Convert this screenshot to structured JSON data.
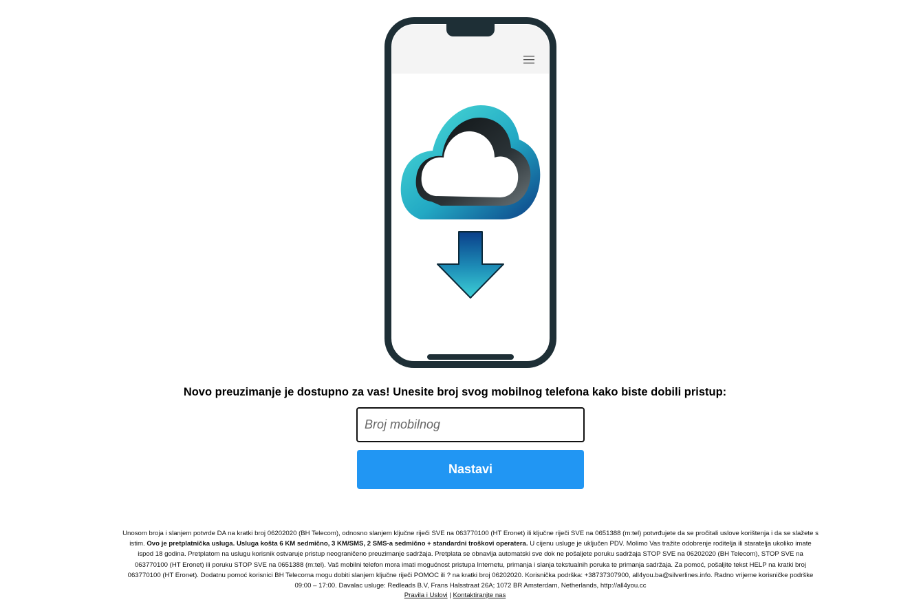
{
  "headline": "Novo preuzimanje je dostupno za vas! Unesite broj svog mobilnog telefona kako biste dobili pristup:",
  "form": {
    "phone_placeholder": "Broj mobilnog",
    "phone_value": "",
    "submit_label": "Nastavi"
  },
  "icons": {
    "phone": "smartphone-icon",
    "menu": "hamburger-menu-icon",
    "cloud": "cloud-icon",
    "download_arrow": "download-arrow-icon"
  },
  "colors": {
    "button": "#2196f3",
    "phone_frame": "#1e2f36",
    "cloud_teal": "#2fc3cc",
    "arrow_dark": "#0a4a8a"
  },
  "terms": {
    "part1": "Unosom broja i slanjem potvrde DA na kratki broj 06202020 (BH Telecom), odnosno slanjem ključne riječi SVE na 063770100 (HT Eronet) ili ključne riječi SVE na 0651388 (m:tel) potvrđujete da se pročitali uslove korištenja i da se slažete s istim. ",
    "bold": "Ovo je pretplatnička usluga. Usluga košta 6 KM sedmično, 3 KM/SMS, 2 SMS-a sedmično + standardni troškovi operatera.",
    "part2": " U cijenu usluge je uključen PDV. Molimo Vas tražite odobrenje roditelja ili staratelja ukoliko imate ispod 18 godina. Pretplatom na uslugu korisnik ostvaruje pristup neograničeno preuzimanje sadržaja. Pretplata se obnavlja automatski sve dok ne pošaljete poruku sadržaja STOP SVE na 06202020 (BH Telecom), STOP SVE na 063770100 (HT Eronet) ili poruku STOP SVE na 0651388 (m:tel). Vaš mobilni telefon mora imati mogućnost pristupa Internetu, primanja i slanja tekstualnih poruka te primanja sadržaja. Za pomoć, pošaljite tekst HELP na kratki broj 063770100 (HT Eronet). Dodatnu pomoć korisnici BH Telecoma mogu dobiti slanjem ključne riječi POMOC ili ? na kratki broj 06202020. Korisnička podrška: +38737307900, all4you.ba@silverlines.info. Radno vrijeme korisničke podrške 09:00 – 17:00. Davalac usluge: Redleads B.V, Frans Halsstraat 26A; 1072 BR Amsterdam, Netherlands, http://all4you.cc"
  },
  "footer": {
    "terms_link": "Pravila i Uslovi",
    "separator": "|",
    "contact_link": "Kontaktiranjte nas"
  }
}
